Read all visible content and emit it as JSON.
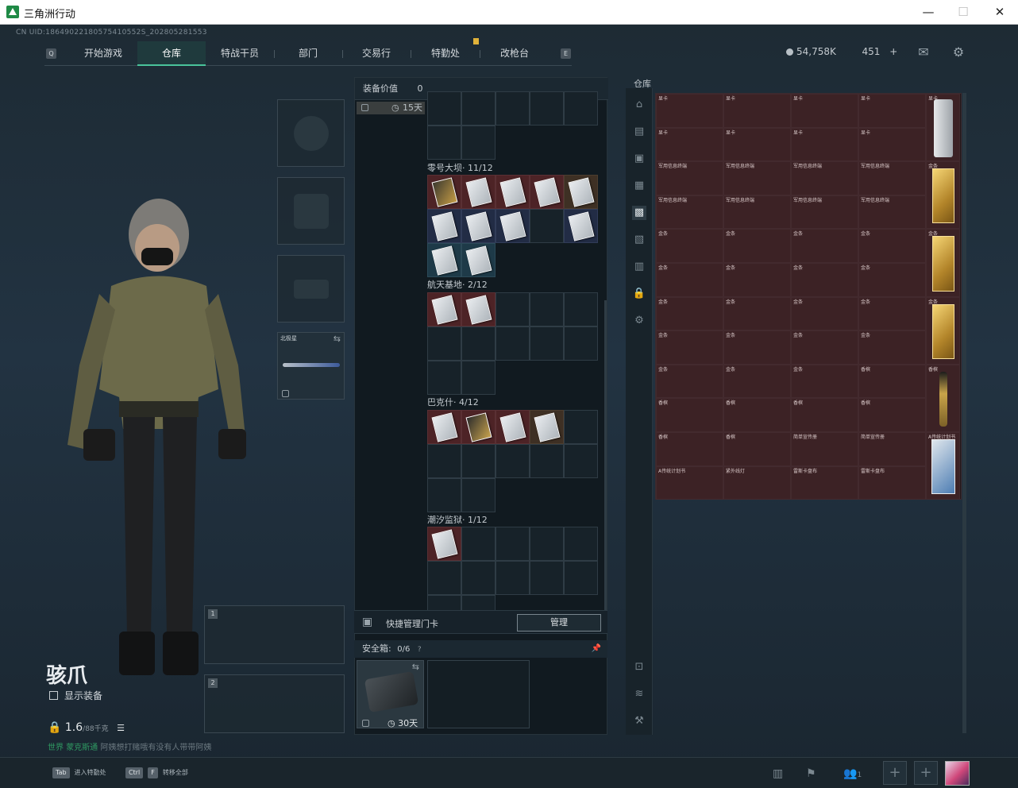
{
  "window": {
    "title": "三角洲行动",
    "minimize": "—",
    "maximize": "☐",
    "close": "✕"
  },
  "uid": "CN UID:18649022180575410552S_202805281553",
  "nav": {
    "left_key": "Q",
    "right_key": "E",
    "items": [
      "开始游戏",
      "仓库",
      "特战干员",
      "部门",
      "交易行",
      "特勤处",
      "改枪台"
    ],
    "active": "仓库"
  },
  "currency": {
    "hafu": "54,758K",
    "coupon": "451",
    "plus": "+"
  },
  "operator": {
    "name": "骇爪",
    "show_equipment": "显示装备",
    "weight": "1.6",
    "weight_max": "/88千克",
    "hint_online": "世界",
    "hint_npc": "蒙克斯通",
    "hint_text": "阿姨想打赌哦有没有人带带阿姨"
  },
  "equip_slots": {
    "melee_label": "北极星"
  },
  "weapon_slots": [
    "1",
    "2"
  ],
  "middle": {
    "equip_value_label": "装备价值",
    "equip_value": "0",
    "top_timer": "15天",
    "containers": [
      {
        "title": "零号大坝· 11/12"
      },
      {
        "title": "航天基地· 2/12"
      },
      {
        "title": "巴克什· 4/12"
      },
      {
        "title": "潮汐监狱· 1/12"
      }
    ],
    "quick_card_label": "快捷管理门卡",
    "manage_button": "管理",
    "safebox_label": "安全箱:",
    "safebox_count": "0/6",
    "safebox_timer": "30天"
  },
  "warehouse": {
    "title": "仓库",
    "labels": {
      "gpu": "显卡",
      "board": "军用信息终端",
      "gold": "金条",
      "champagne": "香槟",
      "film": "A传统计划书",
      "tool": "紧外线灯",
      "cloth": "雷斯卡盘布",
      "paper": "简单宣传册"
    }
  },
  "bottom": {
    "tab_key": "Tab",
    "tab_label": "进入特勤处",
    "ctrl": "Ctrl",
    "f": "F",
    "ctrlf_label": "转移全部",
    "squad_count": "1"
  }
}
